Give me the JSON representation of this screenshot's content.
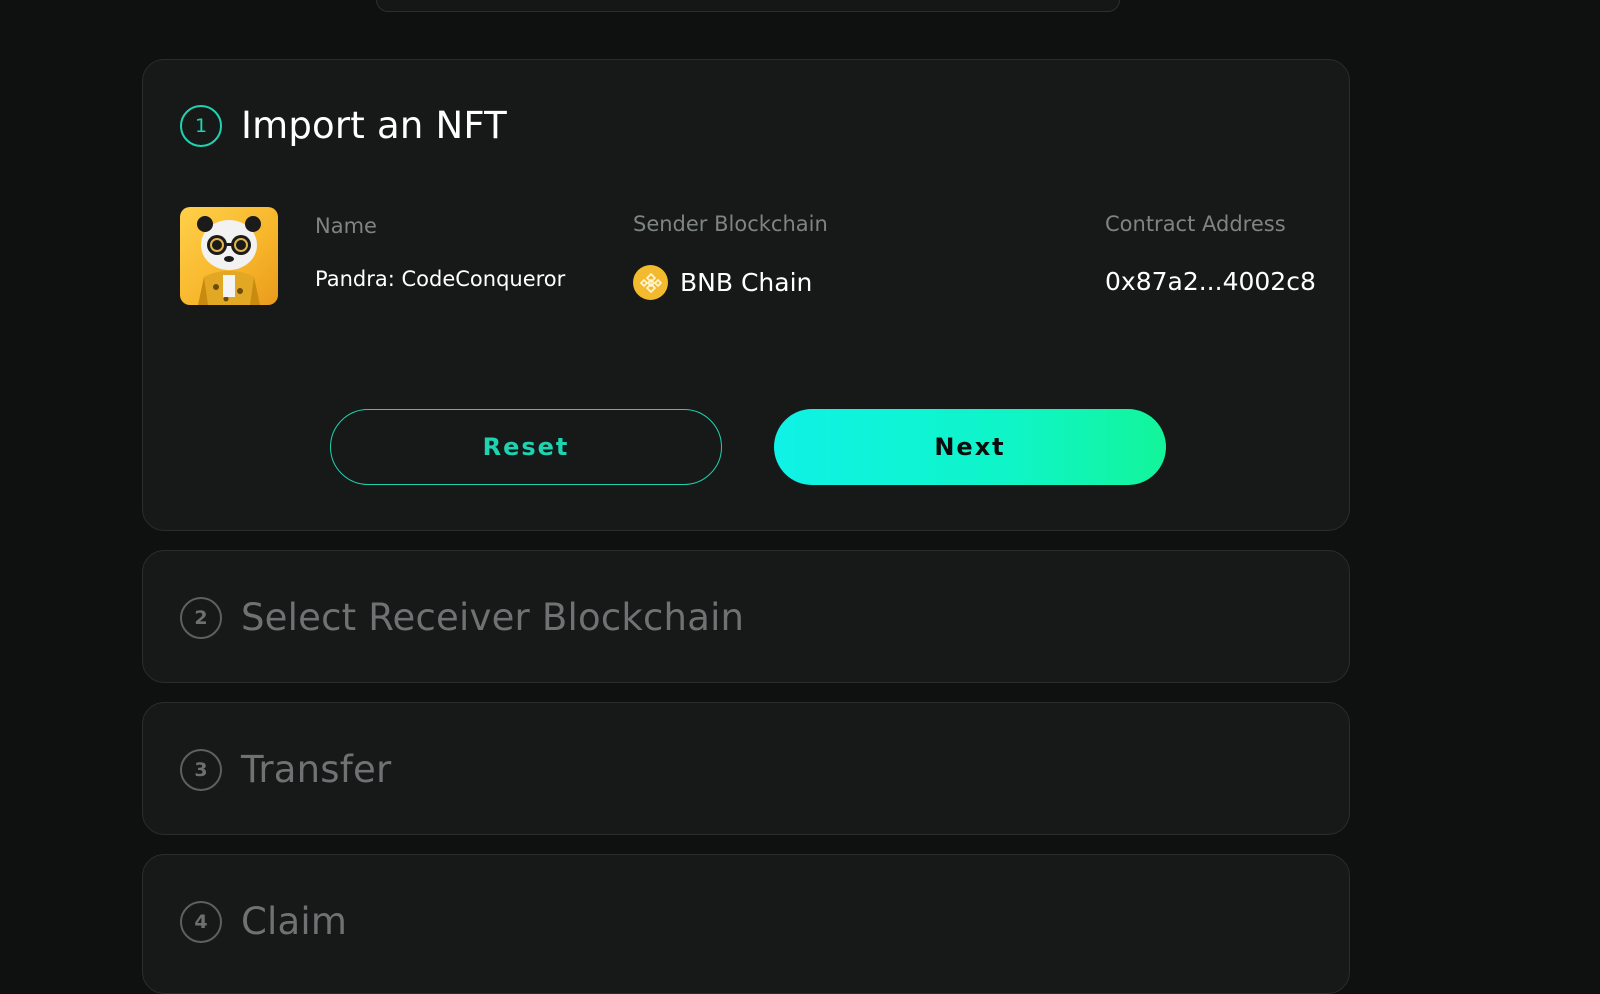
{
  "steps": [
    {
      "number": "1",
      "title": "Import an NFT"
    },
    {
      "number": "2",
      "title": "Select Receiver Blockchain"
    },
    {
      "number": "3",
      "title": "Transfer"
    },
    {
      "number": "4",
      "title": "Claim"
    }
  ],
  "nft": {
    "name_label": "Name",
    "name_value": "Pandra: CodeConqueror",
    "chain_label": "Sender Blockchain",
    "chain_value": "BNB Chain",
    "chain_icon": "bnb-chain-icon",
    "chain_icon_color": "#f3ba2f",
    "contract_label": "Contract Address",
    "contract_value": "0x87a2...4002c8",
    "thumbnail": "nft-thumbnail-panda"
  },
  "buttons": {
    "reset": "Reset",
    "next": "Next"
  },
  "colors": {
    "accent": "#1ed3b0",
    "next_gradient_start": "#0ff2e6",
    "next_gradient_end": "#12f59a"
  }
}
